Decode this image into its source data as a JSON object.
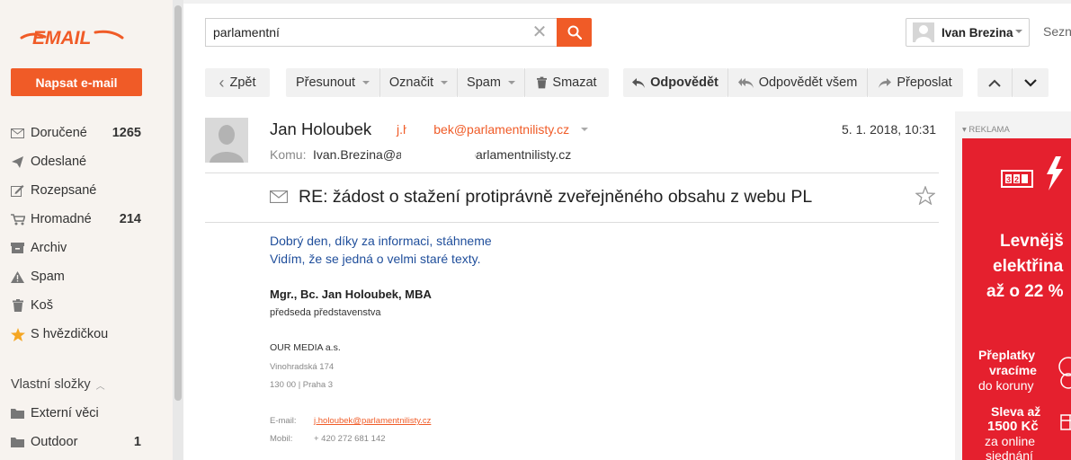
{
  "app": {
    "logo_text": "EMAIL",
    "compose_label": "Napsat e-mail"
  },
  "folders": [
    {
      "label": "Doručené",
      "count": "1265",
      "icon": "inbox-icon"
    },
    {
      "label": "Odeslané",
      "count": "",
      "icon": "send-icon"
    },
    {
      "label": "Rozepsané",
      "count": "",
      "icon": "draft-icon"
    },
    {
      "label": "Hromadné",
      "count": "214",
      "icon": "cart-icon"
    },
    {
      "label": "Archiv",
      "count": "",
      "icon": "archive-icon"
    },
    {
      "label": "Spam",
      "count": "",
      "icon": "warning-icon"
    },
    {
      "label": "Koš",
      "count": "",
      "icon": "trash-icon"
    },
    {
      "label": "S hvězdičkou",
      "count": "",
      "icon": "star-icon"
    }
  ],
  "own_folders": {
    "title": "Vlastní složky",
    "items": [
      {
        "label": "Externí věci",
        "count": "",
        "icon": "folder-icon"
      },
      {
        "label": "Outdoor",
        "count": "1",
        "icon": "folder-icon"
      }
    ]
  },
  "search": {
    "value": "parlamentní"
  },
  "user": {
    "name": "Ivan Brezina"
  },
  "seznam_label": "Sezn",
  "toolbar": {
    "back": "Zpět",
    "move": "Přesunout",
    "mark": "Označit",
    "spam": "Spam",
    "delete": "Smazat",
    "reply": "Odpovědět",
    "reply_all": "Odpovědět všem",
    "forward": "Přeposlat"
  },
  "email": {
    "sender_name": "Jan Holoubek",
    "sender_email": "j.holoubek@parlamentnilisty.cz",
    "date": "5. 1. 2018, 10:31",
    "to_label": "Komu:",
    "to_value": "Ivan.Brezina@a                    polansky@parlamentnilisty.cz",
    "subject": "RE: žádost o stažení protiprávně zveřejněného obsahu z webu PL",
    "body_lines": [
      "Dobrý den, díky za informaci, stáhneme",
      "Vidím, že se jedná o velmi staré texty."
    ],
    "signature": {
      "name": "Mgr., Bc. Jan Holoubek, MBA",
      "role": "předseda představenstva",
      "company": "OUR MEDIA a.s.",
      "address1": "Vinohradská 174",
      "address2": "130 00 | Praha 3",
      "email_label": "E-mail:",
      "email_value": "j.holoubek@parlamentnilisty.cz",
      "phone_label": "Mobil:",
      "phone_value": "+ 420 272 681 142"
    }
  },
  "ad": {
    "label": "▾ REKLAMA",
    "meter": "32",
    "headline1": "Levnějš",
    "headline2": "elektřina",
    "headline3": "až o 22 %",
    "sub1": "Přeplatky",
    "sub2": "vracíme",
    "sub3": "do koruny",
    "sub4": "Sleva až",
    "sub5": "1500 Kč",
    "sub6": "za online",
    "sub7": "sjednání"
  },
  "colors": {
    "accent": "#f05b27",
    "ad_red": "#e5202e",
    "link_blue": "#1f4e9b"
  }
}
